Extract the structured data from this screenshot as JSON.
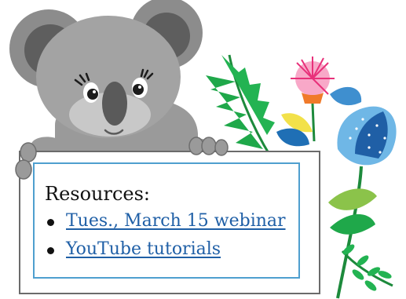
{
  "sign": {
    "heading": "Resources:",
    "links": [
      {
        "label": "Tues., March 15 webinar"
      },
      {
        "label": "YouTube tutorials"
      }
    ]
  },
  "colors": {
    "frame_border": "#6b6b6b",
    "inner_frame": "#4f9fcf",
    "link": "#1f5fa6",
    "koala_fur": "#9a9a9a",
    "koala_dark": "#6e6e6e",
    "leaf_green": "#1fa84a",
    "flower_pink": "#e8307a",
    "flower_blue": "#3f8fcf"
  },
  "illustrations": {
    "mascot": "koala-mascot",
    "plants": "tropical-plants-flowers"
  }
}
